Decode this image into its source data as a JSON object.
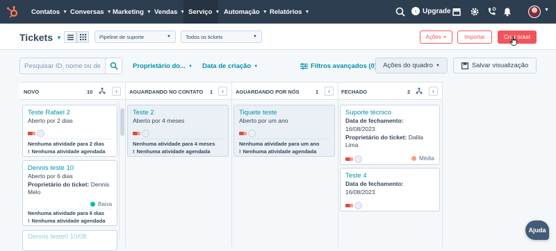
{
  "nav": {
    "items": [
      {
        "label": "Contatos"
      },
      {
        "label": "Conversas"
      },
      {
        "label": "Marketing"
      },
      {
        "label": "Vendas"
      },
      {
        "label": "Serviço"
      },
      {
        "label": "Automação"
      },
      {
        "label": "Relatórios"
      }
    ],
    "upgrade_label": "Upgrade",
    "icons": [
      "search-icon",
      "marketplace-icon",
      "settings-icon",
      "calling-icon",
      "notifications-icon",
      "avatar"
    ]
  },
  "header": {
    "title": "Tickets",
    "pipeline_select": "Pipeline de suporte",
    "tickets_select": "Todos os tickets",
    "actions_label": "Ações",
    "import_label": "Importar",
    "create_label": "Criar ticket"
  },
  "toolbar": {
    "search_placeholder": "Pesquisar ID, nome ou de",
    "owner_filter": "Proprietário do...",
    "created_filter": "Data de criação",
    "advanced_filters": "Filtros avançados (0)",
    "board_actions": "Ações do quadro",
    "save_view": "Salvar visualização"
  },
  "columns": [
    {
      "name": "NOVO",
      "count": "10"
    },
    {
      "name": "AGUARDANDO NO CONTATO",
      "count": "1"
    },
    {
      "name": "AGUARDANDO POR NÓS",
      "count": "1"
    },
    {
      "name": "FECHADO",
      "count": "2"
    }
  ],
  "cards": {
    "novo_1": {
      "title": "Teste Rafael 2",
      "open": "Aberto por 2 dias",
      "activity": "Nenhuma atividade para 2 dias",
      "scheduled": "Nenhuma atividade agendada"
    },
    "novo_2": {
      "title": "Dennis teste 10",
      "open": "Aberto por 6 dias",
      "owner_label": "Proprietário do ticket:",
      "owner_value_1": "Dennis",
      "owner_value_2": "Melo",
      "priority": "Baixa",
      "activity": "Nenhuma atividade para 6 dias",
      "scheduled": "Nenhuma atividade agendada"
    },
    "novo_3": {
      "title": "Dennis teste0 10/08"
    },
    "contato_1": {
      "title": "Teste 2",
      "open": "Aberto por 4 meses",
      "activity": "Nenhuma atividade para 4 meses",
      "scheduled": "Nenhuma atividade agendada"
    },
    "nos_1": {
      "title": "Tiquete teste",
      "open": "Aberto por um ano",
      "activity": "Nenhuma atividade para um ano",
      "scheduled": "Nenhuma atividade agendada"
    },
    "fechado_1": {
      "title": "Suporte técnico",
      "close_label": "Data de fechamento:",
      "close_value": "16/08/2023",
      "owner_label": "Proprietário do ticket:",
      "owner_value_1": "Dalila",
      "owner_value_2": "Lima",
      "priority": "Média"
    },
    "fechado_2": {
      "title": "Teste 4",
      "close_label": "Data de fechamento:",
      "close_value": "16/08/2023"
    }
  },
  "help_label": "Ajuda",
  "colors": {
    "nav_bg": "#2d3e50",
    "accent": "#f2545b",
    "link": "#0091ae",
    "priority_low": "#00bda5",
    "priority_medium": "#f5a26f"
  }
}
